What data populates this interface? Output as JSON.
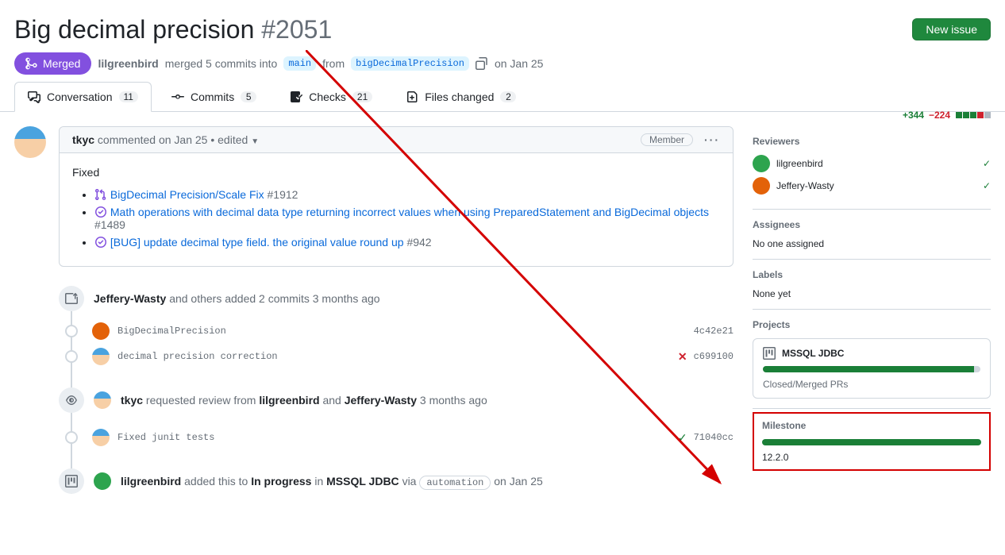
{
  "header": {
    "title": "Big decimal precision",
    "number": "#2051",
    "new_issue_btn": "New issue",
    "state": "Merged",
    "merge_author": "lilgreenbird",
    "merge_text": "merged 5 commits into",
    "base_branch": "main",
    "from_word": "from",
    "head_branch": "bigDecimalPrecision",
    "date": "on Jan 25"
  },
  "tabs": {
    "conversation": {
      "label": "Conversation",
      "count": "11"
    },
    "commits": {
      "label": "Commits",
      "count": "5"
    },
    "checks": {
      "label": "Checks",
      "count": "21"
    },
    "files": {
      "label": "Files changed",
      "count": "2"
    }
  },
  "diffstat": {
    "add": "+344",
    "del": "−224"
  },
  "comment": {
    "author": "tkyc",
    "verb": "commented",
    "when": "on Jan 25",
    "edited": "• edited",
    "role": "Member",
    "body_intro": "Fixed",
    "links": [
      {
        "text": "BigDecimal Precision/Scale Fix",
        "num": "#1912",
        "icon": "pr"
      },
      {
        "text": "Math operations with decimal data type returning incorrect values when using PreparedStatement and BigDecimal objects",
        "num": "#1489",
        "icon": "issue"
      },
      {
        "text": "[BUG] update decimal type field. the original value round up",
        "num": "#942",
        "icon": "issue"
      }
    ]
  },
  "timeline": {
    "push_event": {
      "author": "Jeffery-Wasty",
      "text": "and others added 2 commits 3 months ago"
    },
    "commit1": {
      "msg": "BigDecimalPrecision",
      "hash": "4c42e21"
    },
    "commit2": {
      "msg": "decimal precision correction",
      "hash": "c699100"
    },
    "review_event": {
      "author": "tkyc",
      "mid": "requested review from",
      "r1": "lilgreenbird",
      "and": "and",
      "r2": "Jeffery-Wasty",
      "when": "3 months ago"
    },
    "commit3": {
      "msg": "Fixed junit tests",
      "hash": "71040cc"
    },
    "proj_event": {
      "author": "lilgreenbird",
      "mid": "added this to",
      "col": "In progress",
      "in": "in",
      "proj": "MSSQL JDBC",
      "via": "via",
      "auto": "automation",
      "when": "on Jan 25"
    }
  },
  "sidebar": {
    "reviewers": {
      "heading": "Reviewers",
      "r1": "lilgreenbird",
      "r2": "Jeffery-Wasty"
    },
    "assignees": {
      "heading": "Assignees",
      "none": "No one assigned"
    },
    "labels": {
      "heading": "Labels",
      "none": "None yet"
    },
    "projects": {
      "heading": "Projects",
      "name": "MSSQL JDBC",
      "status": "Closed/Merged PRs"
    },
    "milestone": {
      "heading": "Milestone",
      "name": "12.2.0"
    }
  }
}
